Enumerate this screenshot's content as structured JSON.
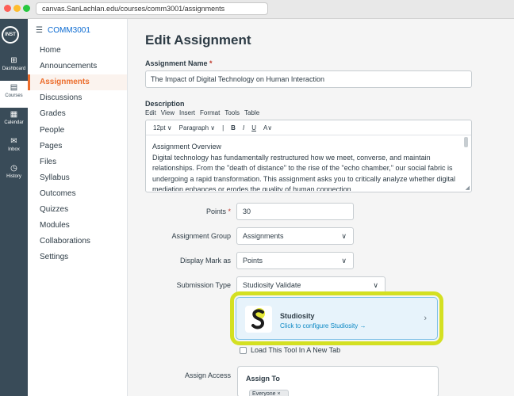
{
  "browser": {
    "url": "canvas.SanLachlan.edu/courses/comm3001/assignments"
  },
  "global_nav": {
    "logo": "INST",
    "items": [
      {
        "label": "Dashboard",
        "icon": "dashboard-icon",
        "glyph": "⊞"
      },
      {
        "label": "Courses",
        "icon": "courses-icon",
        "glyph": "▤"
      },
      {
        "label": "Calendar",
        "icon": "calendar-icon",
        "glyph": "▦"
      },
      {
        "label": "Inbox",
        "icon": "inbox-icon",
        "glyph": "✉"
      },
      {
        "label": "History",
        "icon": "history-icon",
        "glyph": "◷"
      }
    ],
    "active_index": 1
  },
  "course_nav": {
    "course_code": "COMM3001",
    "items": [
      "Home",
      "Announcements",
      "Assignments",
      "Discussions",
      "Grades",
      "People",
      "Pages",
      "Files",
      "Syllabus",
      "Outcomes",
      "Quizzes",
      "Modules",
      "Collaborations",
      "Settings"
    ],
    "active_index": 2
  },
  "page": {
    "title": "Edit Assignment"
  },
  "form": {
    "name_label": "Assignment Name",
    "name_required": "*",
    "name_value": "The Impact of Digital Technology on Human Interaction",
    "description_label": "Description",
    "menu": [
      "Edit",
      "View",
      "Insert",
      "Format",
      "Tools",
      "Table"
    ],
    "toolbar": {
      "font_size": "12pt ∨",
      "block": "Paragraph ∨",
      "sep": "|",
      "bold": "B",
      "italic": "I",
      "underline": "U",
      "text_color": "A∨"
    },
    "description_heading": "Assignment Overview",
    "description_body": "Digital technology has fundamentally restructured how we meet, converse, and maintain relationships. From the \"death of distance\" to the rise of the \"echo chamber,\" our social fabric is undergoing a rapid transformation. This assignment asks you to critically analyze whether digital mediation enhances or erodes the quality of human connection.",
    "points_label": "Points",
    "points_required": "*",
    "points_value": "30",
    "group_label": "Assignment Group",
    "group_value": "Assignments",
    "display_label": "Display Mark as",
    "display_value": "Points",
    "submission_label": "Submission Type",
    "submission_value": "Studiosity Validate",
    "chevron": "∨",
    "tool": {
      "name": "Studiosity",
      "subtitle": "Click to configure Studiosity →",
      "arrow": "›",
      "highlight_color": "#d4e022"
    },
    "new_tab_label": "Load This Tool In A New Tab",
    "new_tab_checked": false,
    "assign_access_label": "Assign Access",
    "assign_to_label": "Assign To",
    "assignee_pill": "Everyone ×"
  }
}
